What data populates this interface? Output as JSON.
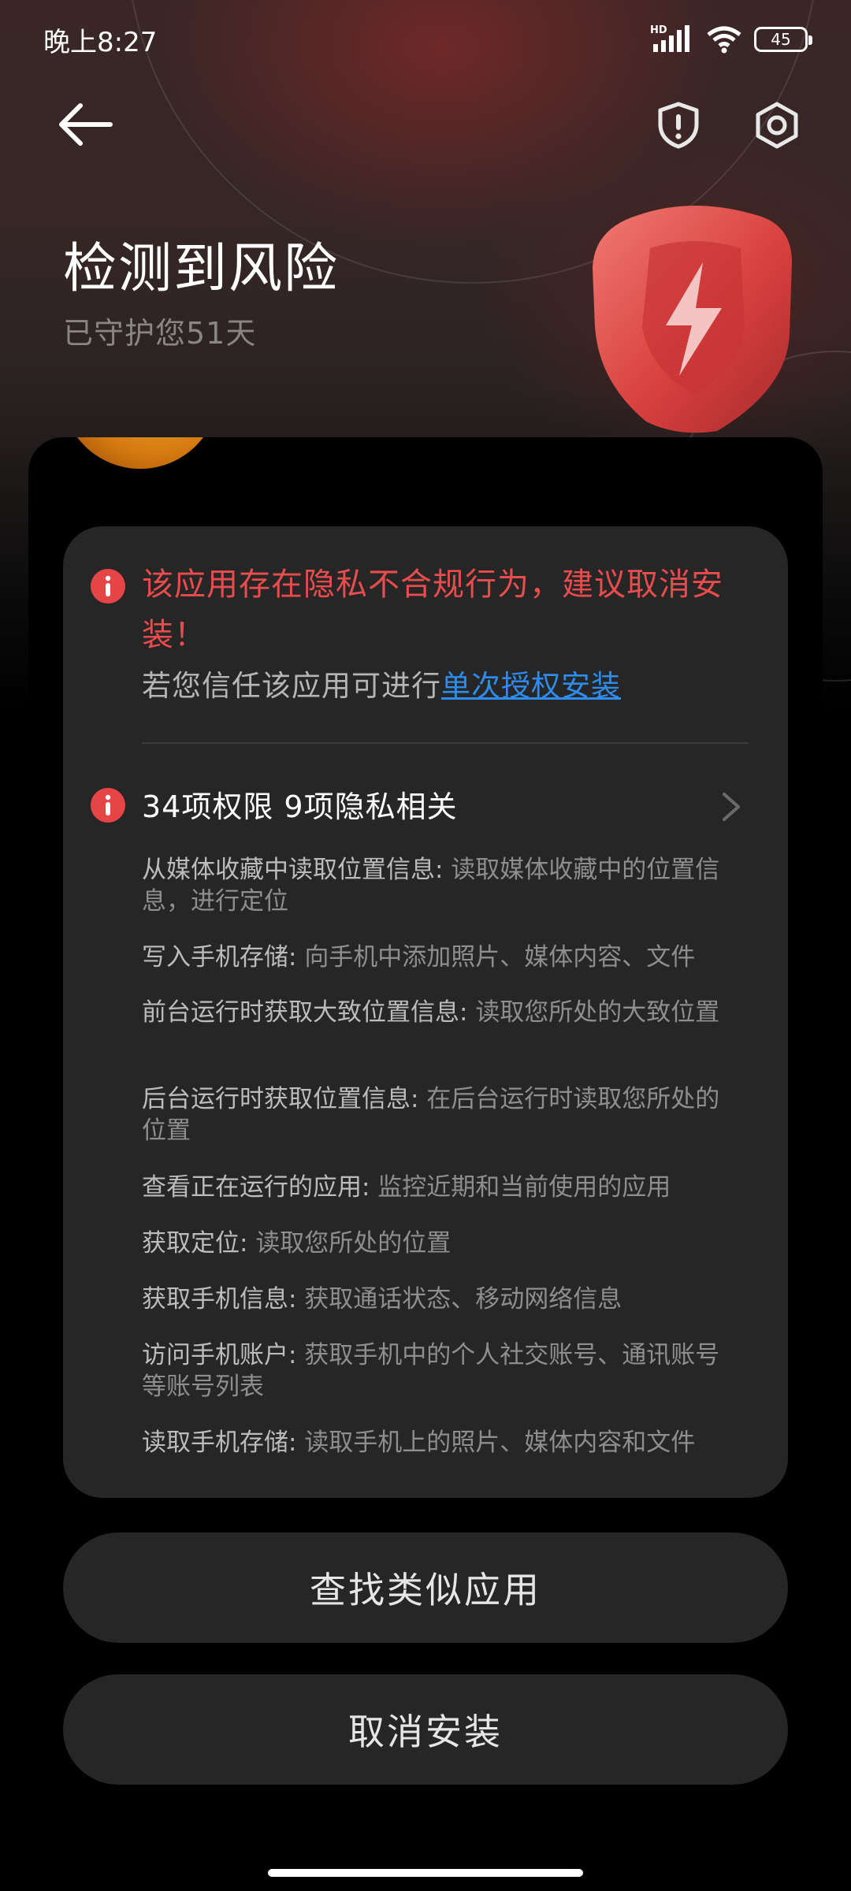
{
  "status_bar": {
    "time": "晚上8:27",
    "network_label": "HD",
    "battery_level": "45"
  },
  "header": {
    "back_icon": "arrow-left-icon",
    "shield_icon": "shield-alert-icon",
    "settings_icon": "settings-hex-icon",
    "title": "检测到风险",
    "subtitle": "已守护您51天"
  },
  "risk_card": {
    "warning_text": "该应用存在隐私不合规行为，建议取消安装！",
    "trust_prefix": "若您信任该应用可进行",
    "trust_link": "单次授权安装",
    "permissions_title": "34项权限 9项隐私相关",
    "permissions": [
      {
        "name": "从媒体收藏中读取位置信息",
        "desc": "读取媒体收藏中的位置信息，进行定位"
      },
      {
        "name": "写入手机存储",
        "desc": "向手机中添加照片、媒体内容、文件"
      },
      {
        "name": "前台运行时获取大致位置信息",
        "desc": "读取您所处的大致位置"
      },
      {
        "name": "后台运行时获取位置信息",
        "desc": "在后台运行时读取您所处的位置"
      },
      {
        "name": "查看正在运行的应用",
        "desc": "监控近期和当前使用的应用"
      },
      {
        "name": "获取定位",
        "desc": "读取您所处的位置"
      },
      {
        "name": "获取手机信息",
        "desc": "获取通话状态、移动网络信息"
      },
      {
        "name": "访问手机账户",
        "desc": "获取手机中的个人社交账号、通讯账号等账号列表"
      },
      {
        "name": "读取手机存储",
        "desc": "读取手机上的照片、媒体内容和文件"
      }
    ]
  },
  "actions": {
    "find_similar": "查找类似应用",
    "cancel_install": "取消安装"
  },
  "colors": {
    "warning_red": "#e94c4c",
    "link_blue": "#2e8cf0",
    "card_bg": "#262626"
  }
}
